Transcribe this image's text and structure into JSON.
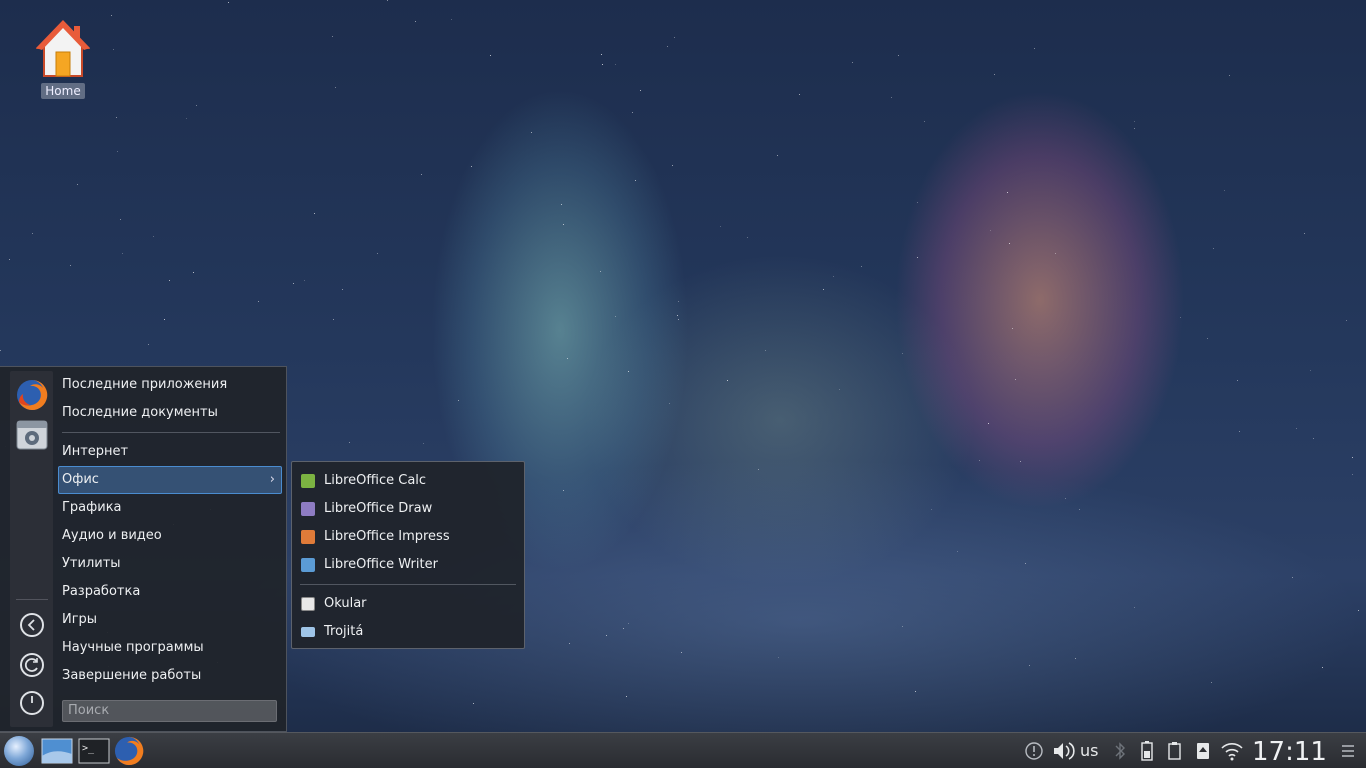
{
  "desktop": {
    "home_icon_label": "Home"
  },
  "start_menu": {
    "items": [
      {
        "label": "Последние приложения"
      },
      {
        "label": "Последние документы"
      },
      {
        "label": "Интернет"
      },
      {
        "label": "Офис"
      },
      {
        "label": "Графика"
      },
      {
        "label": "Аудио и видео"
      },
      {
        "label": "Утилиты"
      },
      {
        "label": "Разработка"
      },
      {
        "label": "Игры"
      },
      {
        "label": "Научные программы"
      },
      {
        "label": "Завершение работы"
      }
    ],
    "active_item": "Офис",
    "search_placeholder": "Поиск",
    "favorites": [
      "firefox-icon",
      "system-settings-icon"
    ],
    "system_buttons": [
      "back-icon",
      "restart-icon",
      "power-icon"
    ]
  },
  "submenu": {
    "items": [
      {
        "label": "LibreOffice Calc",
        "icon": "libreoffice-calc-icon",
        "color": "#7cb342"
      },
      {
        "label": "LibreOffice Draw",
        "icon": "libreoffice-draw-icon",
        "color": "#8e7cc3"
      },
      {
        "label": "LibreOffice Impress",
        "icon": "libreoffice-impress-icon",
        "color": "#e07b39"
      },
      {
        "label": "LibreOffice Writer",
        "icon": "libreoffice-writer-icon",
        "color": "#5b9bd5"
      },
      {
        "label": "Okular",
        "icon": "okular-icon",
        "color": "#dddddd"
      },
      {
        "label": "Trojitá",
        "icon": "trojita-icon",
        "color": "#9fc5e8"
      }
    ]
  },
  "taskbar": {
    "apps": [
      "launcher-icon",
      "desktop-pager-icon",
      "terminal-icon",
      "firefox-icon"
    ],
    "tray": {
      "keyboard_layout": "us",
      "icons": [
        "notifications-icon",
        "volume-icon",
        "bluetooth-icon",
        "battery-icon",
        "clipboard-icon",
        "devices-icon",
        "wifi-icon",
        "menu-icon"
      ]
    },
    "clock": "17:11"
  },
  "colors": {
    "accent": "#4a8cd0",
    "menu_bg": "#20242b",
    "taskbar_bg": "#2d2f34"
  }
}
